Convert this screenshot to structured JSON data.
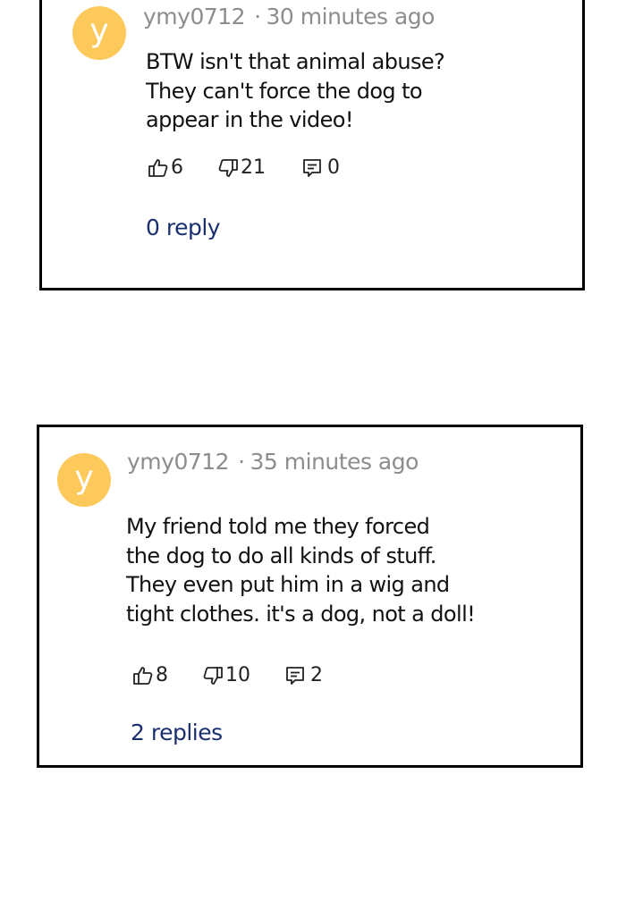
{
  "comments": [
    {
      "avatar_letter": "y",
      "username": "ymy0712",
      "separator": "·",
      "time": "30 minutes ago",
      "text": "BTW isn't that animal abuse?\nThey can't force the dog to\nappear in the video!",
      "likes": "6",
      "dislikes": "21",
      "comments": "0",
      "replies_label": "0 reply"
    },
    {
      "avatar_letter": "y",
      "username": "ymy0712",
      "separator": "·",
      "time": "35 minutes ago",
      "text": "My friend told me they forced\nthe dog to do all kinds of stuff.\nThey even put him in a wig and\ntight clothes. it's a dog, not a doll!",
      "likes": "8",
      "dislikes": "10",
      "comments": "2",
      "replies_label": "2 replies"
    }
  ],
  "colors": {
    "avatar_bg": "#fcc95a",
    "meta_text": "#8d8d8d",
    "reply_link": "#1a2f6e",
    "border": "#000000"
  },
  "icons": [
    "thumbs-up-icon",
    "thumbs-down-icon",
    "comment-icon"
  ]
}
